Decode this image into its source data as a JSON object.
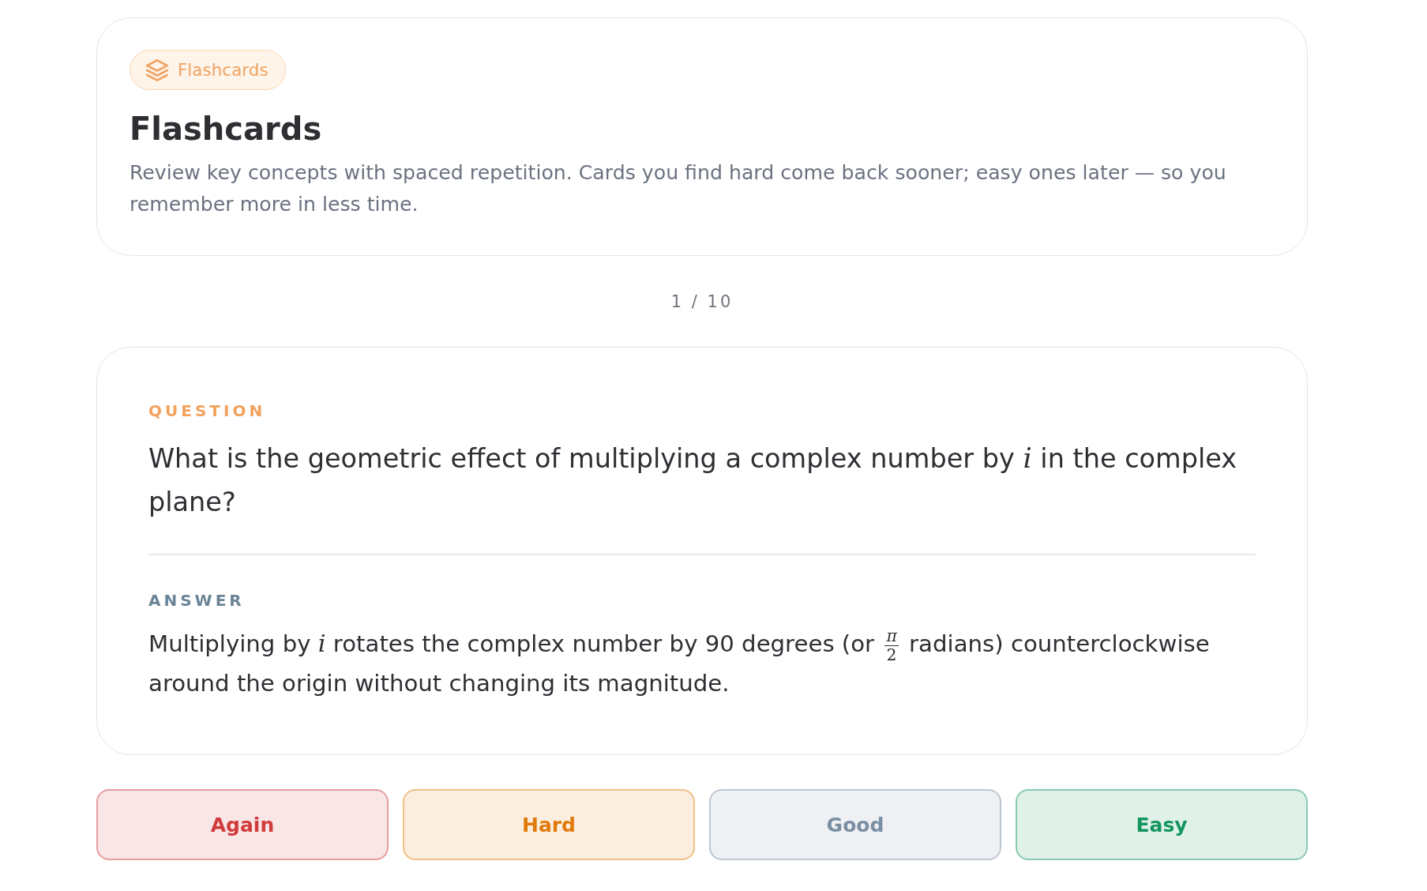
{
  "header": {
    "badge": "Flashcards",
    "title": "Flashcards",
    "description": "Review key concepts with spaced repetition. Cards you find hard come back sooner; easy ones later — so you remember more in less time."
  },
  "counter": "1 / 10",
  "card": {
    "question": {
      "label": "QUESTION",
      "parts": [
        {
          "kind": "text",
          "text": "What is the geometric effect of multiplying a complex number by "
        },
        {
          "kind": "math",
          "text": "i"
        },
        {
          "kind": "text",
          "text": " in the complex plane?"
        }
      ]
    },
    "answer": {
      "label": "ANSWER",
      "parts": [
        {
          "kind": "text",
          "text": "Multiplying by "
        },
        {
          "kind": "math",
          "text": "i"
        },
        {
          "kind": "text",
          "text": " rotates the complex number by 90 degrees (or "
        },
        {
          "kind": "fraction",
          "numerator": "π",
          "denominator": "2"
        },
        {
          "kind": "text",
          "text": " radians) counterclockwise around the origin without changing its magnitude."
        }
      ]
    }
  },
  "buttons": [
    {
      "label": "Again",
      "color": "#d13b3b"
    },
    {
      "label": "Hard",
      "color": "#e07b0a"
    },
    {
      "label": "Good",
      "color": "#7a8fa3"
    },
    {
      "label": "Easy",
      "color": "#12965e"
    }
  ]
}
